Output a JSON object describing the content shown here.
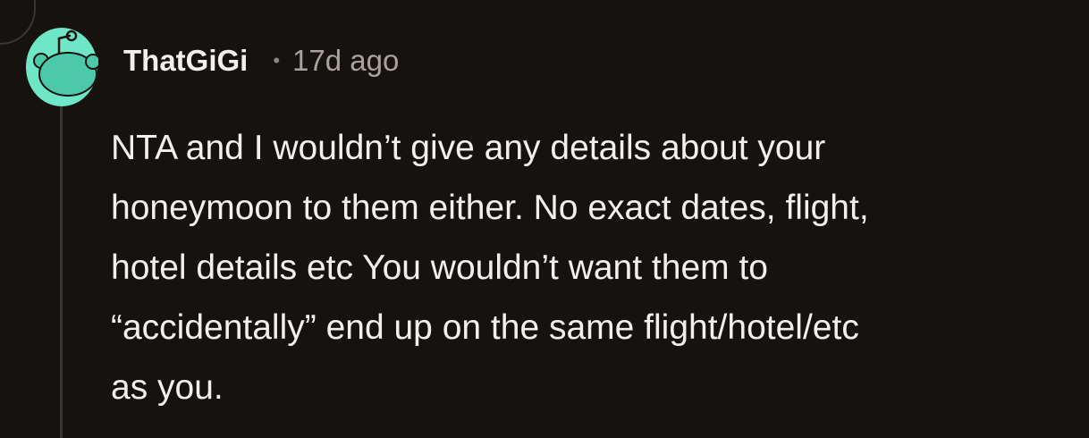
{
  "comment": {
    "author": "ThatGiGi",
    "separator": "•",
    "timestamp": "17d ago",
    "body": "NTA and I wouldn’t give any details about your\nhoneymoon to them either. No exact dates, flight,\nhotel details etc You wouldn’t want them to\n“accidentally” end up on the same flight/hotel/etc\nas you."
  },
  "avatar": {
    "icon": "snoo-avatar-icon",
    "color": "#6fe6c5"
  },
  "colors": {
    "background": "#161210",
    "text": "#f2efec",
    "muted": "#aaa39c",
    "thread_line": "#3a3532"
  }
}
